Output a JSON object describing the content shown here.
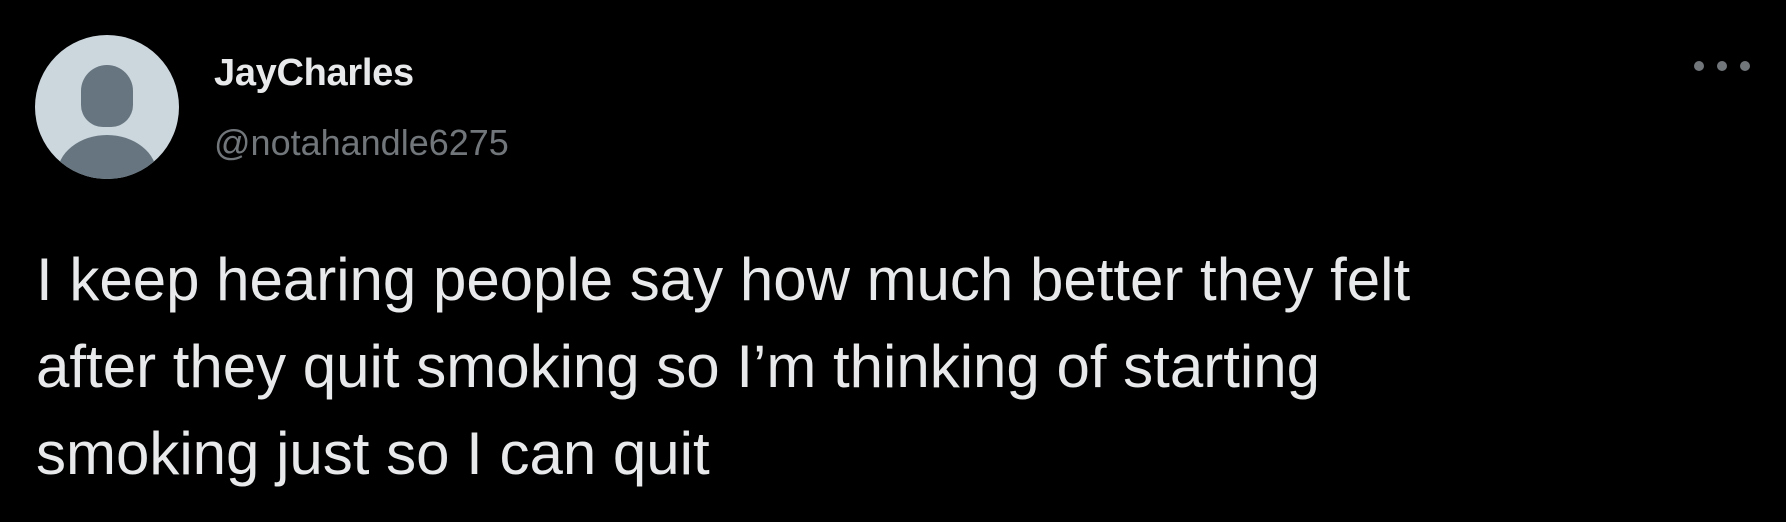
{
  "tweet": {
    "display_name": "JayCharles",
    "handle": "@notahandle6275",
    "text_lines": [
      "I keep hearing people say how much better they felt",
      "after they quit smoking so I’m thinking of starting",
      "smoking just so I can quit"
    ],
    "avatar_icon": "default-profile-silhouette-icon",
    "more_icon": "more-horizontal-icon"
  },
  "colors": {
    "background": "#000000",
    "primary_text": "#e7e9ea",
    "secondary_text": "#71767b",
    "avatar_bg": "#ccd6dd",
    "avatar_fg": "#66757f"
  }
}
